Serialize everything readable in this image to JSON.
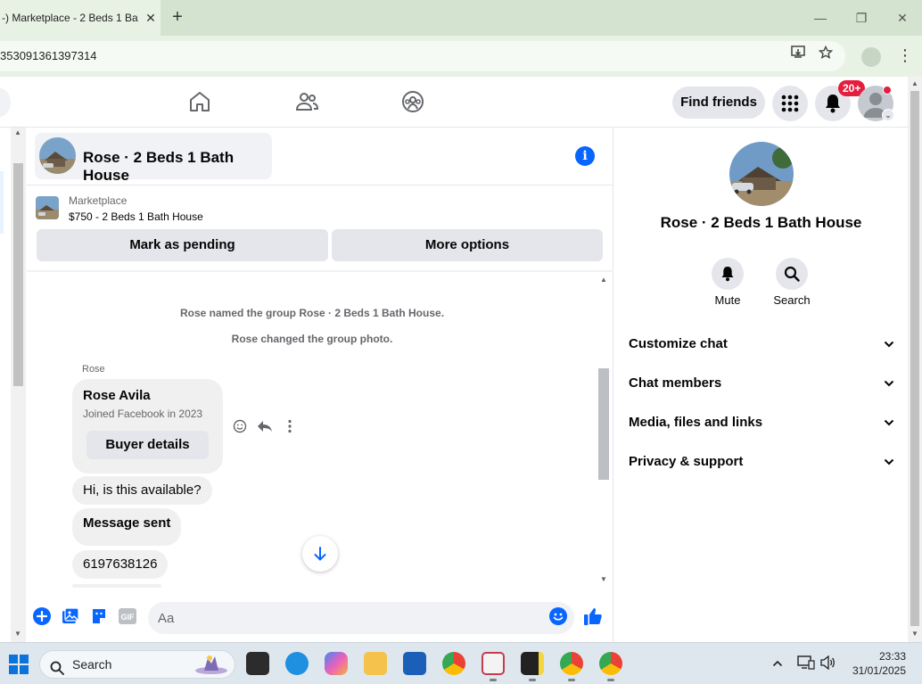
{
  "browser": {
    "tab_title": "-) Marketplace - 2 Beds 1 Ba",
    "url_fragment": "353091361397314",
    "controls": {
      "minimize": "—",
      "maximize": "❐",
      "close": "✕"
    }
  },
  "header": {
    "find_friends_label": "Find friends",
    "notification_badge": "20+",
    "icons": [
      "home-icon",
      "friends-icon",
      "groups-icon",
      "menu-grid-icon",
      "bell-icon"
    ]
  },
  "chat": {
    "title": "Rose · 2 Beds 1 Bath House",
    "listing": {
      "label": "Marketplace",
      "price_title": "$750 - 2 Beds 1 Bath House"
    },
    "buttons": {
      "mark_pending": "Mark as pending",
      "more_options": "More options"
    },
    "system_messages": [
      "Rose named the group Rose · 2 Beds 1 Bath House.",
      "Rose changed the group photo."
    ],
    "sender_name": "Rose",
    "profile_card": {
      "name": "Rose Avila",
      "joined": "Joined Facebook in 2023",
      "button": "Buyer details"
    },
    "messages": [
      {
        "text": "Hi, is this available?",
        "bold": false
      },
      {
        "text": "Message sent",
        "bold": true
      },
      {
        "text": "6197638126",
        "bold": false
      }
    ],
    "composer_placeholder": "Aa"
  },
  "details_panel": {
    "title": "Rose · 2 Beds 1 Bath House",
    "actions": {
      "mute": "Mute",
      "search": "Search"
    },
    "sections": [
      "Customize chat",
      "Chat members",
      "Media, files and links",
      "Privacy & support"
    ]
  },
  "taskbar": {
    "search_label": "Search",
    "time": "23:33",
    "date": "31/01/2025"
  },
  "colors": {
    "accent": "#0866ff",
    "badge": "#e41e3f",
    "bubble": "#f0f0f0"
  }
}
